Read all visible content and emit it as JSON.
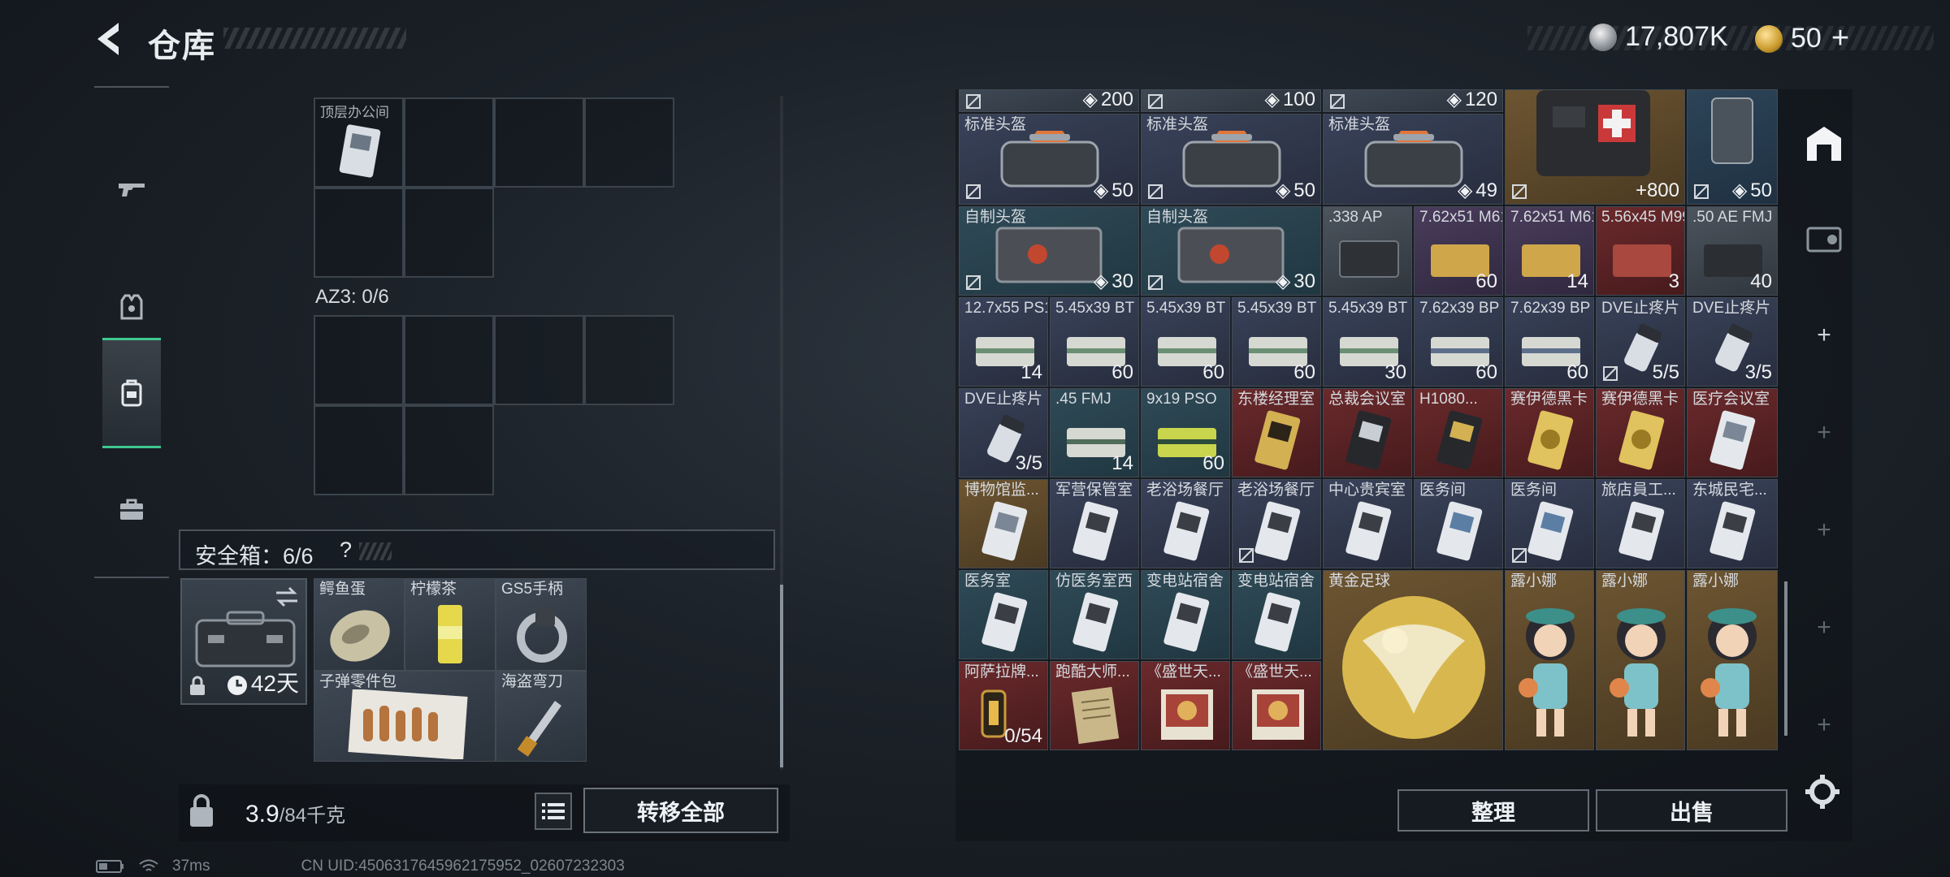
{
  "header": {
    "title": "仓库",
    "silver_amount": "17,807K",
    "gold_amount": "50",
    "plus": "+"
  },
  "left_nav": [
    "weapon-tab",
    "armor-tab",
    "backpack-tab",
    "case-tab"
  ],
  "storage": {
    "room_label": "顶层办公间",
    "az3_label": "AZ3: 0/6",
    "safe_title": "安全箱：6/6",
    "safe_help": "?",
    "safe_days": "42天",
    "safe_items": [
      {
        "name": "鳄鱼蛋"
      },
      {
        "name": "柠檬茶"
      },
      {
        "name": "GS5手柄"
      },
      {
        "name": "子弹零件包"
      },
      {
        "name": "海盗弯刀"
      }
    ]
  },
  "weight": {
    "value": "3.9",
    "unit": "/84千克"
  },
  "buttons": {
    "transfer_all": "转移全部",
    "sort": "整理",
    "sell": "出售"
  },
  "status": {
    "ping": "37ms",
    "uid": "CN UID:4506317645962175952_02607232303"
  },
  "inventory": {
    "row0": [
      {
        "armor": "200"
      },
      {
        "armor": "100"
      },
      {
        "armor": "120"
      }
    ],
    "bags": [
      {
        "name": "标准头盔",
        "armor": "50"
      },
      {
        "name": "标准头盔",
        "armor": "50"
      },
      {
        "name": "标准头盔",
        "armor": "49"
      },
      {
        "name": "",
        "heal": "+800"
      },
      {
        "name": "",
        "armor": "50"
      }
    ],
    "row2": [
      {
        "name": "自制头盔",
        "armor": "30"
      },
      {
        "name": "自制头盔",
        "armor": "30"
      },
      {
        "name": ".338 AP",
        "count": ""
      },
      {
        "name": "7.62x51 M61",
        "count": "60"
      },
      {
        "name": "7.62x51 M61",
        "count": "14"
      },
      {
        "name": "5.56x45 M995",
        "count": "3"
      },
      {
        "name": ".50 AE FMJ",
        "count": "40"
      }
    ],
    "row3": [
      {
        "name": "12.7x55 PS12",
        "count": "14"
      },
      {
        "name": "5.45x39 BT",
        "count": "60"
      },
      {
        "name": "5.45x39 BT",
        "count": "60"
      },
      {
        "name": "5.45x39 BT",
        "count": "60"
      },
      {
        "name": "5.45x39 BT",
        "count": "30"
      },
      {
        "name": "7.62x39 BP",
        "count": "60"
      },
      {
        "name": "7.62x39 BP",
        "count": "60"
      },
      {
        "name": "DVE止疼片",
        "count": "5/5"
      },
      {
        "name": "DVE止疼片",
        "count": "3/5"
      }
    ],
    "row4": [
      {
        "name": "DVE止疼片",
        "count": "3/5"
      },
      {
        "name": ".45 FMJ",
        "count": "14"
      },
      {
        "name": "9x19 PSO",
        "count": "60"
      },
      {
        "name": "东楼经理室",
        "count": ""
      },
      {
        "name": "总裁会议室",
        "count": ""
      },
      {
        "name": "H1080...",
        "count": ""
      },
      {
        "name": "赛伊德黑卡",
        "count": ""
      },
      {
        "name": "赛伊德黑卡",
        "count": ""
      },
      {
        "name": "医疗会议室",
        "count": ""
      }
    ],
    "row5": [
      {
        "name": "博物馆监..."
      },
      {
        "name": "军营保管室"
      },
      {
        "name": "老浴场餐厅"
      },
      {
        "name": "老浴场餐厅"
      },
      {
        "name": "中心贵宾室"
      },
      {
        "name": "医务间"
      },
      {
        "name": "医务间"
      },
      {
        "name": "旅店員工..."
      },
      {
        "name": "东城民宅..."
      }
    ],
    "row6": [
      {
        "name": "医务室"
      },
      {
        "name": "仿医务室西"
      },
      {
        "name": "变电站宿舍"
      },
      {
        "name": "变电站宿舍"
      }
    ],
    "football": {
      "name": "黄金足球"
    },
    "dolls": [
      {
        "name": "露小娜"
      },
      {
        "name": "露小娜"
      },
      {
        "name": "露小娜"
      }
    ],
    "row7": [
      {
        "name": "阿萨拉牌...",
        "count": "0/54"
      },
      {
        "name": "跑酷大师..."
      },
      {
        "name": "《盛世天..."
      },
      {
        "name": "《盛世天..."
      }
    ]
  }
}
